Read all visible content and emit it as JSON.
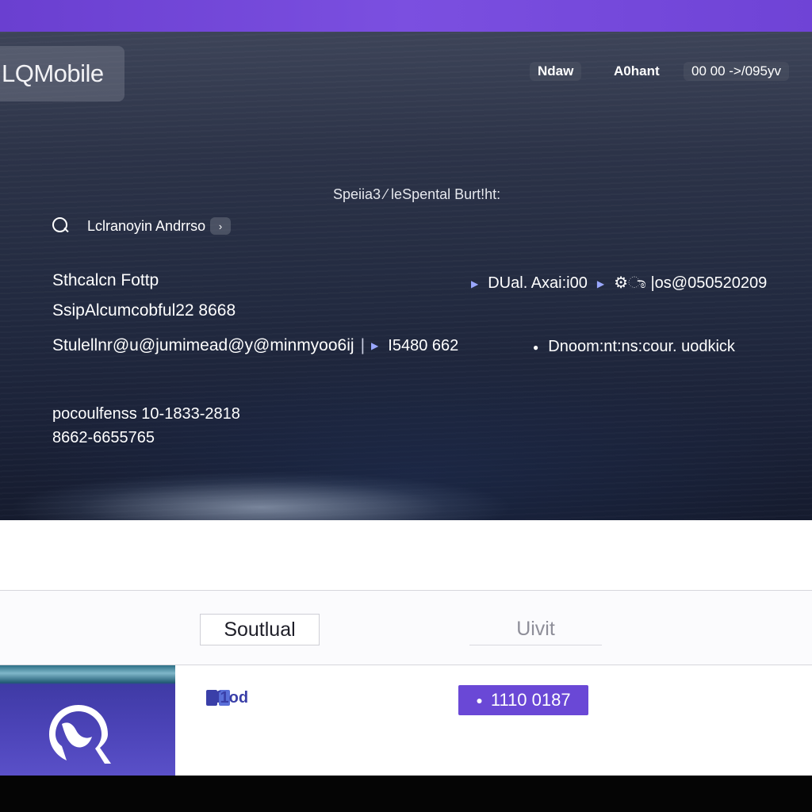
{
  "header": {
    "logo": "LQMobile",
    "nav": [
      "Ndaw",
      "A0hant",
      "00 00 ->/095yv"
    ]
  },
  "hero": {
    "subheading": "Speiia3  ⁄ leSpental  Burt!ht:",
    "search_label": "Lclranoyin Andrrso",
    "search_chevron": "›",
    "info": {
      "row1_left": "Sthcalcn Fottp",
      "row1_right_a": "DUal. Axai:i00",
      "row1_right_b": "⚙ಾ |os@050520209",
      "row2_left": "SsipAlcumcobful22 8668",
      "row3_left": "Stulellnr@u@jumimead@y@minmyoo6ij",
      "row3_mid": "I5480 662",
      "row3_right": "Dnoom:nt:ns:cour. uodkick",
      "row4_a": "pocoulfenss 10-1833-2818",
      "row4_b": "8662-6655765"
    }
  },
  "tabs": {
    "tab1": "Soutlual",
    "tab2": "Uivit"
  },
  "bottom": {
    "small_icon_label": "ſ1od",
    "badge": "1110  0187",
    "badge_icon": "user-icon"
  },
  "colors": {
    "accent": "#6a48d6",
    "topbar": "#7145d8"
  }
}
